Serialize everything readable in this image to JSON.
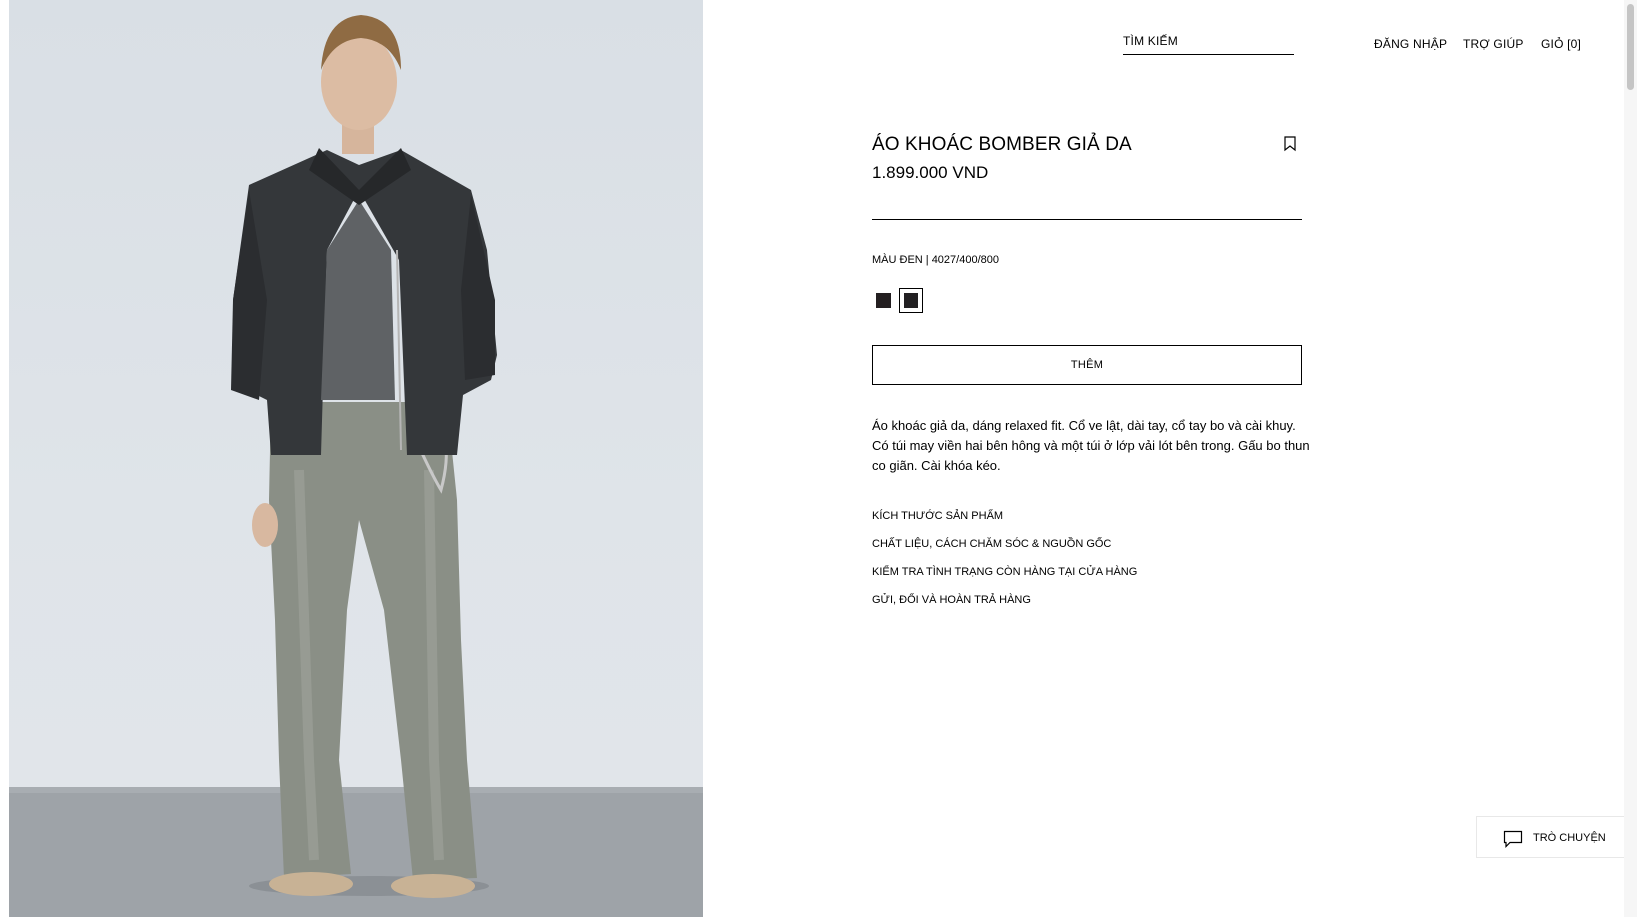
{
  "header": {
    "search_label": "TÌM KIẾM",
    "login_label": "ĐĂNG NHẬP",
    "help_label": "TRỢ GIÚP",
    "cart_label": "GIỎ [0]"
  },
  "product": {
    "title": "ÁO KHOÁC BOMBER GIẢ DA",
    "price": "1.899.000 VND",
    "color_line": "MÀU ĐEN | 4027/400/800",
    "swatches": [
      {
        "color": "#241f21",
        "selected": false
      },
      {
        "color": "#222022",
        "selected": true
      }
    ],
    "add_label": "THÊM",
    "description": "Áo khoác giả da, dáng relaxed fit. Cổ ve lật, dài tay, cổ tay bo và cài khuy. Có túi may viền hai bên hông và một túi ở lớp vải lót bên trong. Gấu bo thun co giãn. Cài khóa kéo.",
    "links": [
      "KÍCH THƯỚC SẢN PHẨM",
      "CHẤT LIỆU, CÁCH CHĂM SÓC & NGUỒN GỐC",
      "KIỂM TRA TÌNH TRẠNG CÒN HÀNG TẠI CỬA HÀNG",
      "GỬI, ĐỔI VÀ HOÀN TRẢ HÀNG"
    ]
  },
  "chat": {
    "label": "TRÒ CHUYỆN"
  },
  "icons": {
    "bookmark": "bookmark-icon",
    "chat": "chat-bubble-icon"
  }
}
